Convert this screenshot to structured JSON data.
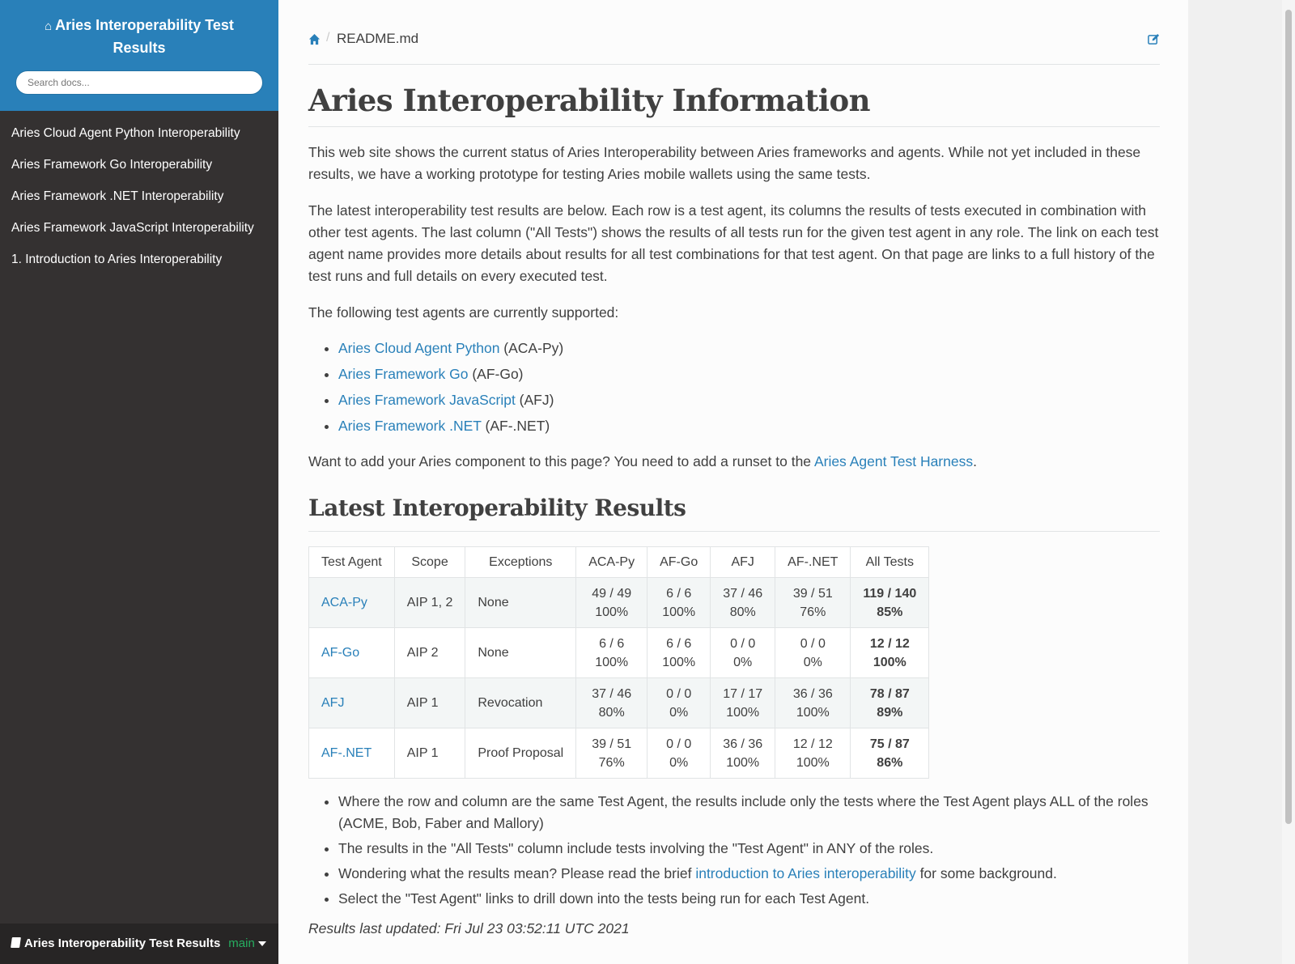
{
  "sidebar": {
    "title": "Aries Interoperability Test Results",
    "search_placeholder": "Search docs...",
    "items": [
      {
        "label": "Aries Cloud Agent Python Interoperability"
      },
      {
        "label": "Aries Framework Go Interoperability"
      },
      {
        "label": "Aries Framework .NET Interoperability"
      },
      {
        "label": "Aries Framework JavaScript Interoperability"
      },
      {
        "label": "1. Introduction to Aries Interoperability"
      }
    ],
    "footer": {
      "label": "Aries Interoperability Test Results",
      "branch": "main"
    }
  },
  "breadcrumb": {
    "file": "README.md",
    "separator": "/"
  },
  "page": {
    "title": "Aries Interoperability Information",
    "intro": "This web site shows the current status of Aries Interoperability between Aries frameworks and agents. While not yet included in these results, we have a working prototype for testing Aries mobile wallets using the same tests.",
    "latest": "The latest interoperability test results are below. Each row is a test agent, its columns the results of tests executed in combination with other test agents. The last column (\"All Tests\") shows the results of all tests run for the given test agent in any role. The link on each test agent name provides more details about results for all test combinations for that test agent. On that page are links to a full history of the test runs and full details on every executed test.",
    "following": "The following test agents are currently supported:",
    "agents": [
      {
        "link": "Aries Cloud Agent Python",
        "abbr": " (ACA-Py)"
      },
      {
        "link": "Aries Framework Go",
        "abbr": " (AF-Go)"
      },
      {
        "link": "Aries Framework JavaScript",
        "abbr": " (AFJ)"
      },
      {
        "link": "Aries Framework .NET",
        "abbr": " (AF-.NET)"
      }
    ],
    "add_prefix": "Want to add your Aries component to this page? You need to add a runset to the ",
    "add_link": "Aries Agent Test Harness",
    "add_suffix": ".",
    "results_heading": "Latest Interoperability Results",
    "notes": {
      "n1": "Where the row and column are the same Test Agent, the results include only the tests where the Test Agent plays ALL of the roles (ACME, Bob, Faber and Mallory)",
      "n2": "The results in the \"All Tests\" column include tests involving the \"Test Agent\" in ANY of the roles.",
      "n3_prefix": "Wondering what the results mean? Please read the brief ",
      "n3_link": "introduction to Aries interoperability",
      "n3_suffix": " for some background.",
      "n4": "Select the \"Test Agent\" links to drill down into the tests being run for each Test Agent."
    },
    "updated": "Results last updated: Fri Jul 23 03:52:11 UTC 2021"
  },
  "table": {
    "headers": [
      "Test Agent",
      "Scope",
      "Exceptions",
      "ACA-Py",
      "AF-Go",
      "AFJ",
      "AF-.NET",
      "All Tests"
    ],
    "rows": [
      {
        "agent": "ACA-Py",
        "scope": "AIP 1, 2",
        "exceptions": "None",
        "cells": [
          [
            "49 / 49",
            "100%"
          ],
          [
            "6 / 6",
            "100%"
          ],
          [
            "37 / 46",
            "80%"
          ],
          [
            "39 / 51",
            "76%"
          ]
        ],
        "all": [
          "119 / 140",
          "85%"
        ]
      },
      {
        "agent": "AF-Go",
        "scope": "AIP 2",
        "exceptions": "None",
        "cells": [
          [
            "6 / 6",
            "100%"
          ],
          [
            "6 / 6",
            "100%"
          ],
          [
            "0 / 0",
            "0%"
          ],
          [
            "0 / 0",
            "0%"
          ]
        ],
        "all": [
          "12 / 12",
          "100%"
        ]
      },
      {
        "agent": "AFJ",
        "scope": "AIP 1",
        "exceptions": "Revocation",
        "cells": [
          [
            "37 / 46",
            "80%"
          ],
          [
            "0 / 0",
            "0%"
          ],
          [
            "17 / 17",
            "100%"
          ],
          [
            "36 / 36",
            "100%"
          ]
        ],
        "all": [
          "78 / 87",
          "89%"
        ]
      },
      {
        "agent": "AF-.NET",
        "scope": "AIP 1",
        "exceptions": "Proof Proposal",
        "cells": [
          [
            "39 / 51",
            "76%"
          ],
          [
            "0 / 0",
            "0%"
          ],
          [
            "36 / 36",
            "100%"
          ],
          [
            "12 / 12",
            "100%"
          ]
        ],
        "all": [
          "75 / 87",
          "86%"
        ]
      }
    ]
  },
  "colors": {
    "sidebar_header": "#2980b9",
    "sidebar_bg": "#343131",
    "link": "#2980b9",
    "branch": "#27ae60"
  }
}
